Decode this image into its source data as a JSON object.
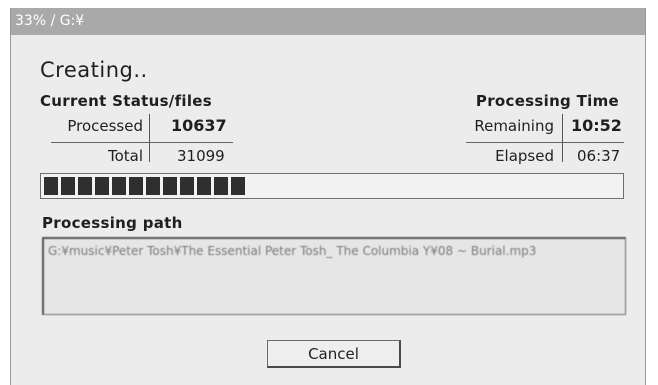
{
  "window": {
    "title": "33% / G:¥"
  },
  "heading": "Creating..",
  "status": {
    "label": "Current Status/files",
    "processed_label": "Processed",
    "processed_value": "10637",
    "total_label": "Total",
    "total_value": "31099"
  },
  "time": {
    "label": "Processing Time",
    "remaining_label": "Remaining",
    "remaining_value": "10:52",
    "elapsed_label": "Elapsed",
    "elapsed_value": "06:37"
  },
  "progress": {
    "percent": 33,
    "filled_blocks": 12
  },
  "path": {
    "label": "Processing path",
    "value": "G:¥music¥Peter Tosh¥The Essential Peter Tosh_ The Columbia Y¥08 ~ Burial.mp3"
  },
  "buttons": {
    "cancel_label": "Cancel"
  }
}
